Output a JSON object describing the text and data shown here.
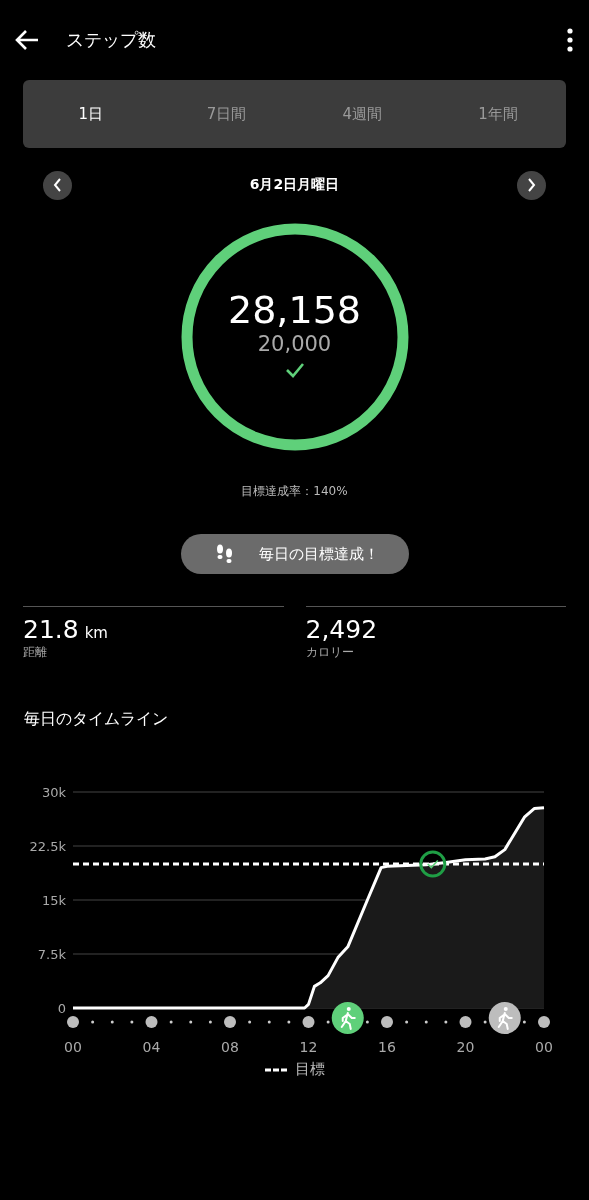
{
  "header": {
    "title": "ステップ数"
  },
  "tabs": [
    {
      "label": "1日",
      "selected": true
    },
    {
      "label": "7日間",
      "selected": false
    },
    {
      "label": "4週間",
      "selected": false
    },
    {
      "label": "1年間",
      "selected": false
    }
  ],
  "date": "6月2日月曜日",
  "ring": {
    "steps": "28,158",
    "goal": "20,000",
    "level": 1,
    "achieved": true
  },
  "rate": "目標達成率：140%",
  "badge": "毎日の目標達成！",
  "stats": [
    {
      "value": "21.8",
      "unit": "km",
      "label": "距離"
    },
    {
      "value": "2,492",
      "label": "カロリー"
    }
  ],
  "timeline": {
    "title": "毎日のタイムライン",
    "chart_data": {
      "type": "line",
      "x": [
        0,
        11.8,
        12,
        12.3,
        12.6,
        13,
        13.5,
        14,
        15,
        15.7,
        16,
        18,
        19,
        20,
        21,
        21.5,
        22,
        23,
        23.5,
        24
      ],
      "series": [
        {
          "color": "#ffffff",
          "values": [
            0,
            0,
            500,
            3000,
            3500,
            4500,
            7000,
            8500,
            15000,
            19500,
            19700,
            19900,
            20200,
            20600,
            20700,
            21000,
            22000,
            26500,
            27700,
            27800
          ]
        }
      ],
      "grid": true,
      "xlim": [
        0,
        24
      ],
      "ylim": [
        0,
        30000
      ],
      "xticks": [
        {
          "value": 0,
          "label": "00"
        },
        {
          "value": 4,
          "label": "04"
        },
        {
          "value": 8,
          "label": "08"
        },
        {
          "value": 12,
          "label": "12"
        },
        {
          "value": 16,
          "label": "16"
        },
        {
          "value": 20,
          "label": "20"
        },
        {
          "value": 24,
          "label": "00"
        }
      ],
      "yticks": [
        {
          "value": 0,
          "label": "0"
        },
        {
          "value": 7500,
          "label": "7.5k"
        },
        {
          "value": 15000,
          "label": "15k"
        },
        {
          "value": 22500,
          "label": "22.5k"
        },
        {
          "value": 30000,
          "label": "30k"
        }
      ],
      "ref_lines": [
        {
          "axis": "y",
          "value": 20000,
          "label": "目標"
        }
      ]
    },
    "activities": [
      {
        "kind": "walk",
        "color": "#5fd07a"
      },
      {
        "kind": "walk",
        "color": "#bdbdbd"
      }
    ]
  }
}
